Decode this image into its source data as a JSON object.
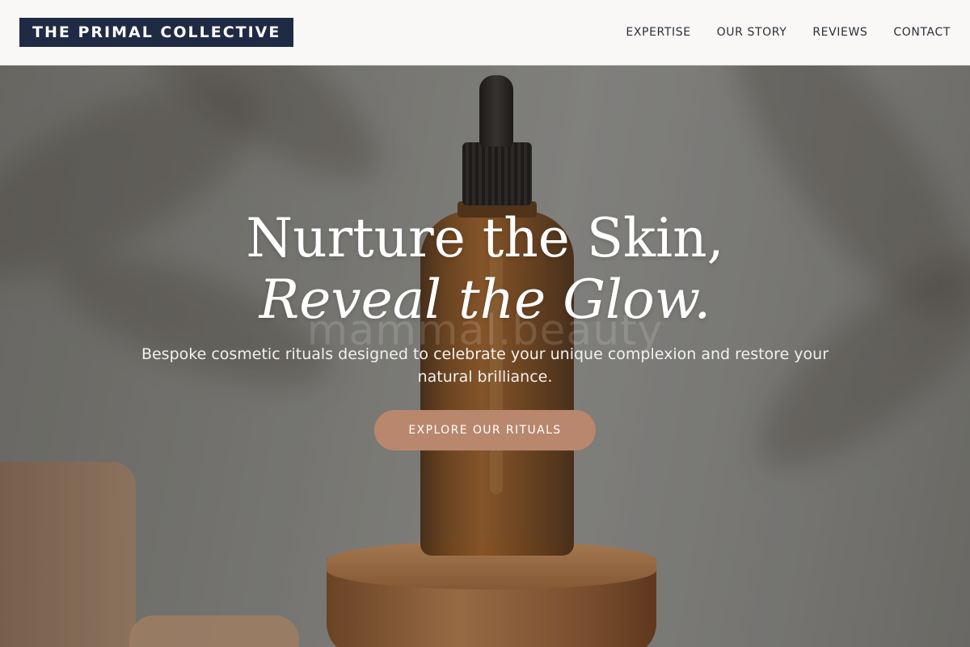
{
  "header": {
    "logo": "THE PRIMAL COLLECTIVE",
    "nav": [
      {
        "label": "EXPERTISE"
      },
      {
        "label": "OUR STORY"
      },
      {
        "label": "REVIEWS"
      },
      {
        "label": "CONTACT"
      }
    ]
  },
  "hero": {
    "headline_line1": "Nurture the Skin,",
    "headline_line2": "Reveal the Glow.",
    "watermark": "mammal.beauty",
    "subtext": "Bespoke cosmetic rituals designed to celebrate your unique complexion and restore your natural brilliance.",
    "cta_label": "EXPLORE OUR RITUALS"
  },
  "colors": {
    "logo_bg": "#1f2a44",
    "header_bg": "#f9f8f6",
    "cta_bg": "#b9876e"
  }
}
